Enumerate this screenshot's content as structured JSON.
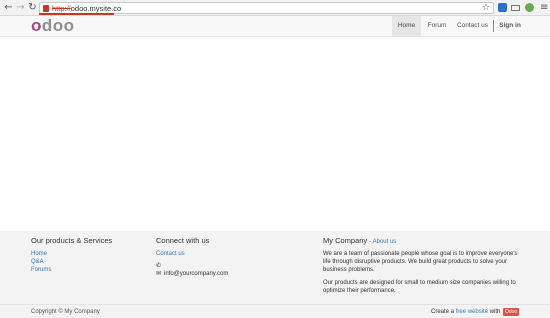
{
  "browser": {
    "url_scheme": "http://",
    "url_host": "odoo.mysite.co"
  },
  "header": {
    "logo": "odoo",
    "nav": [
      {
        "label": "Home",
        "active": true
      },
      {
        "label": "Forum"
      },
      {
        "label": "Contact us"
      }
    ],
    "signin": "Sign in"
  },
  "footer": {
    "products": {
      "title": "Our products & Services",
      "links": [
        "Home",
        "Q&A",
        "Forums"
      ]
    },
    "connect": {
      "title": "Connect with us",
      "contact_link": "Contact us",
      "phone": "",
      "email": "info@yourcompany.com"
    },
    "company": {
      "title": "My Company",
      "about_link": "- About us",
      "para1_l1": "We are a team of passionate people whose goal is to improve everyone's",
      "para1_l2": "life through disruptive products. We build great products to solve your",
      "para1_l3": "business problems.",
      "para2_l1": "Our products are designed for small to medium size companies willing to",
      "para2_l2": "optimize their performance."
    }
  },
  "copyright": {
    "text": "Copyright © My Company",
    "create_prefix": "Create a",
    "create_link": "free website",
    "create_suffix": "with",
    "badge": "Odoo"
  },
  "colors": {
    "brand_purple": "#a24689",
    "link_blue": "#337ab7",
    "badge_red": "#d9534f"
  }
}
